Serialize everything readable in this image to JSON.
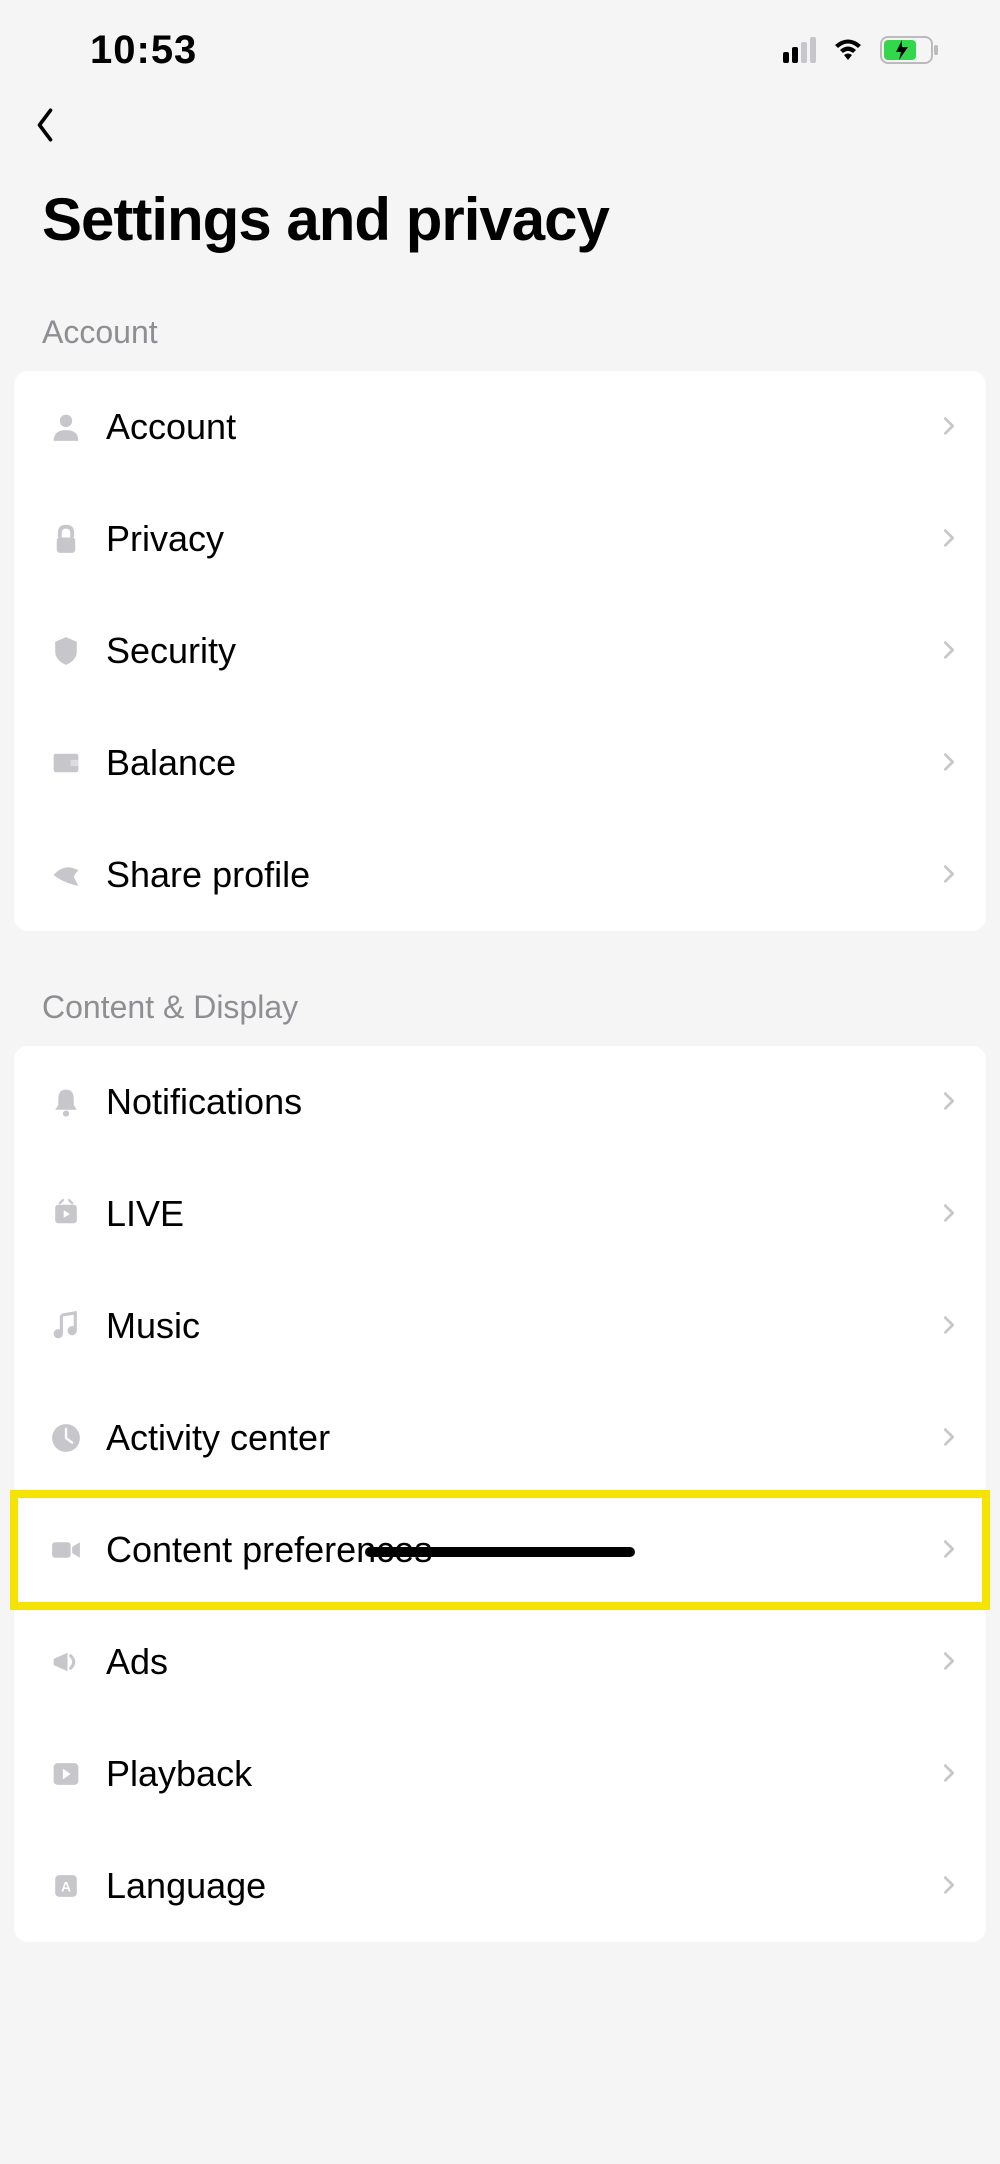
{
  "statusBar": {
    "time": "10:53"
  },
  "page": {
    "title": "Settings and privacy"
  },
  "sections": [
    {
      "header": "Account",
      "items": [
        {
          "icon": "person-icon",
          "label": "Account"
        },
        {
          "icon": "lock-icon",
          "label": "Privacy"
        },
        {
          "icon": "shield-icon",
          "label": "Security"
        },
        {
          "icon": "wallet-icon",
          "label": "Balance"
        },
        {
          "icon": "share-icon",
          "label": "Share profile"
        }
      ]
    },
    {
      "header": "Content & Display",
      "items": [
        {
          "icon": "bell-icon",
          "label": "Notifications"
        },
        {
          "icon": "live-icon",
          "label": "LIVE"
        },
        {
          "icon": "music-icon",
          "label": "Music"
        },
        {
          "icon": "clock-icon",
          "label": "Activity center"
        },
        {
          "icon": "video-icon",
          "label": "Content preferences",
          "highlighted": true
        },
        {
          "icon": "megaphone-icon",
          "label": "Ads"
        },
        {
          "icon": "playback-icon",
          "label": "Playback"
        },
        {
          "icon": "language-icon",
          "label": "Language"
        }
      ]
    }
  ]
}
